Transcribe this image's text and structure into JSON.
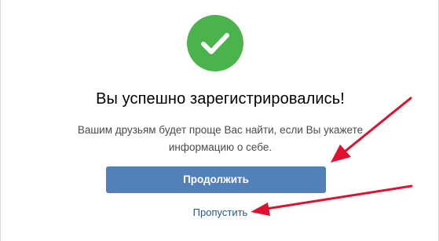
{
  "success": {
    "icon": "checkmark-icon",
    "color": "#4bb34b"
  },
  "title": "Вы успешно зарегистрировались!",
  "description": {
    "line1": "Вашим друзьям будет проще Вас найти, если Вы укажете",
    "line2": "информацию о себе."
  },
  "continue_button": {
    "label": "Продолжить",
    "color": "#5181b8"
  },
  "skip_link": {
    "label": "Пропустить",
    "color": "#2a5885"
  },
  "annotation": {
    "arrow_color": "#e0102e"
  }
}
